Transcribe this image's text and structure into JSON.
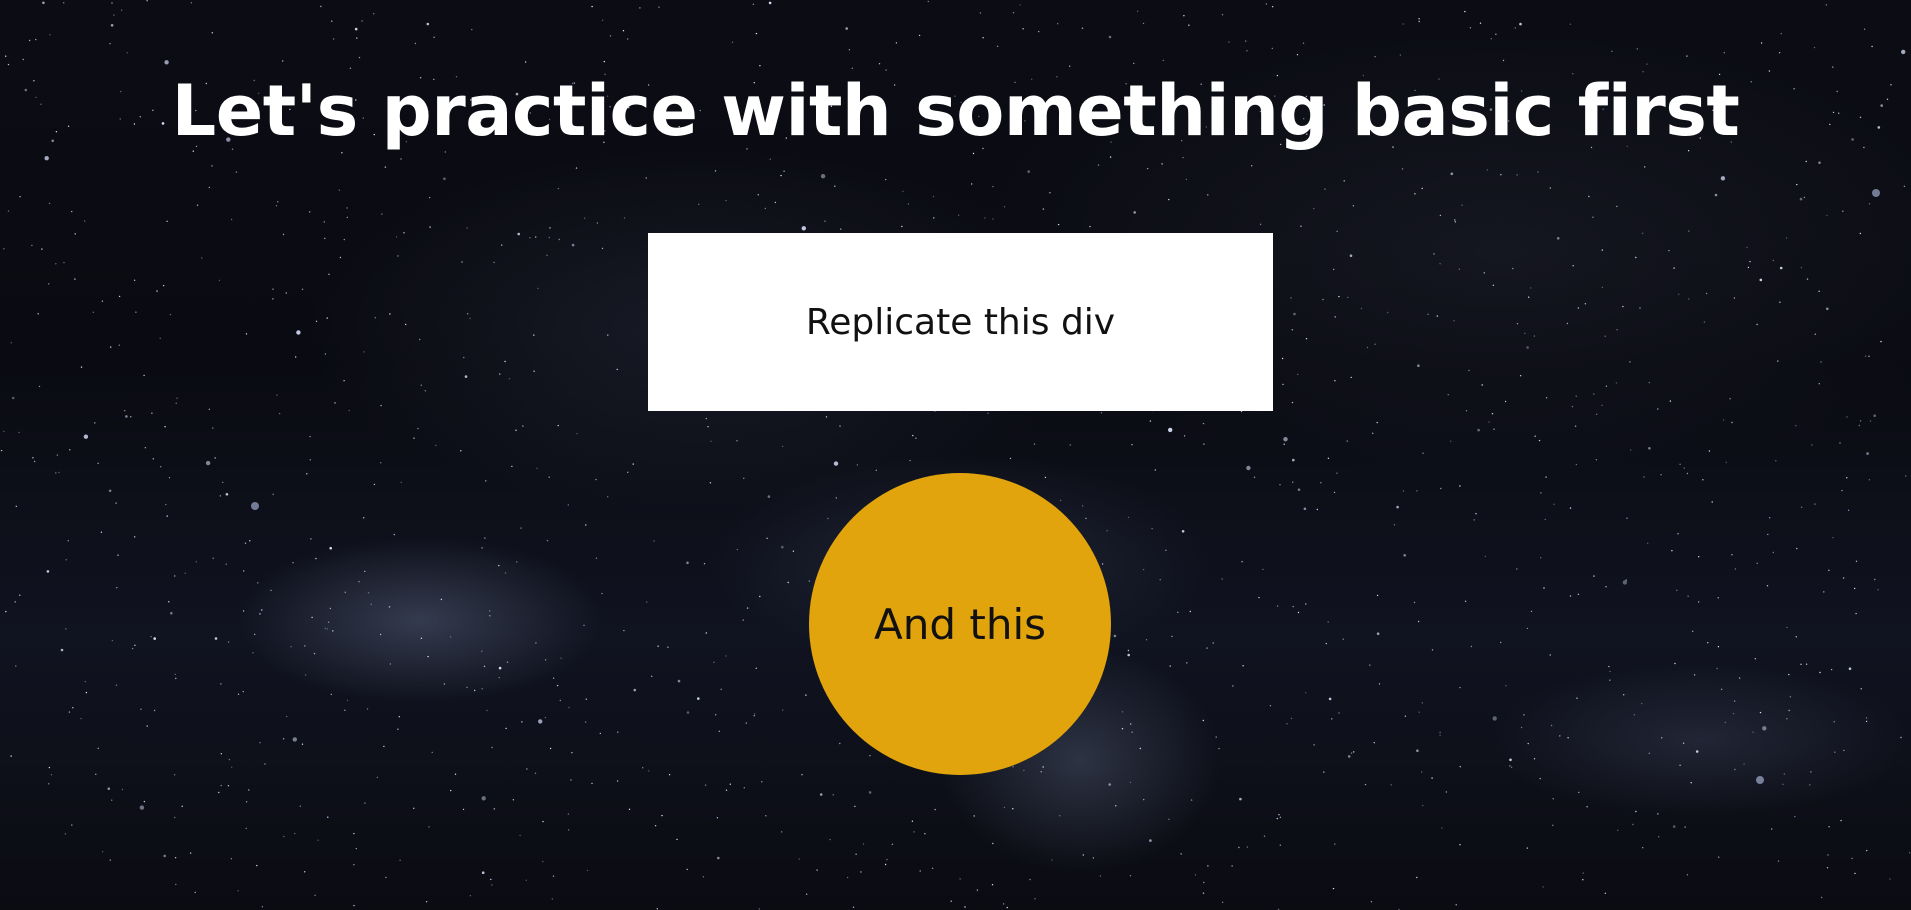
{
  "heading": {
    "title": "Let's practice with something basic first"
  },
  "box": {
    "label": "Replicate this div",
    "background": "#ffffff"
  },
  "circle": {
    "label": "And this",
    "background": "#e1a40c"
  },
  "background": {
    "description_color": "#07070b"
  }
}
